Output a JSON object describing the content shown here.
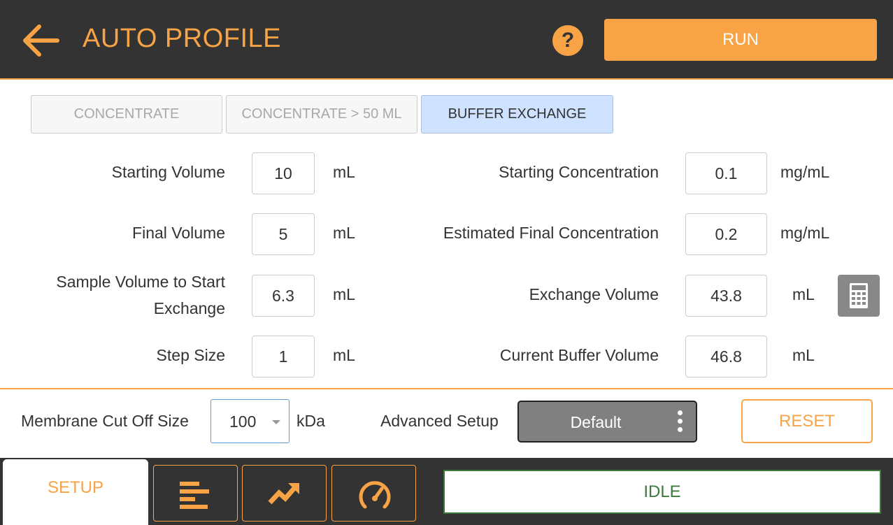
{
  "header": {
    "title": "AUTO PROFILE",
    "help_label": "?",
    "run_label": "RUN"
  },
  "modes": [
    {
      "label": "CONCENTRATE",
      "active": false
    },
    {
      "label": "CONCENTRATE > 50 ML",
      "active": false
    },
    {
      "label": "BUFFER EXCHANGE",
      "active": true
    }
  ],
  "left_fields": [
    {
      "label": "Starting Volume",
      "value": "10",
      "unit": "mL"
    },
    {
      "label": "Final Volume",
      "value": "5",
      "unit": "mL"
    },
    {
      "label_line1": "Sample Volume to Start",
      "label_line2": "Exchange",
      "value": "6.3",
      "unit": "mL"
    },
    {
      "label": "Step Size",
      "value": "1",
      "unit": "mL"
    }
  ],
  "right_fields": [
    {
      "label": "Starting Concentration",
      "value": "0.1",
      "unit": "mg/mL"
    },
    {
      "label": "Estimated Final Concentration",
      "value": "0.2",
      "unit": "mg/mL"
    },
    {
      "label": "Exchange Volume",
      "value": "43.8",
      "unit": "mL"
    },
    {
      "label": "Current Buffer Volume",
      "value": "46.8",
      "unit": "mL"
    }
  ],
  "settings": {
    "membrane_label": "Membrane Cut Off Size",
    "membrane_value": "100",
    "membrane_unit": "kDa",
    "advanced_label": "Advanced Setup",
    "advanced_value": "Default",
    "reset_label": "RESET"
  },
  "footer": {
    "setup_tab_label": "SETUP",
    "status": "IDLE",
    "nav_icons": [
      "list-icon",
      "trend-chart-icon",
      "gauge-icon"
    ]
  },
  "colors": {
    "accent": "#F7A346",
    "header_bg": "#333333",
    "active_tab_bg": "#CFE2FF",
    "status_green": "#3C7A3C"
  }
}
